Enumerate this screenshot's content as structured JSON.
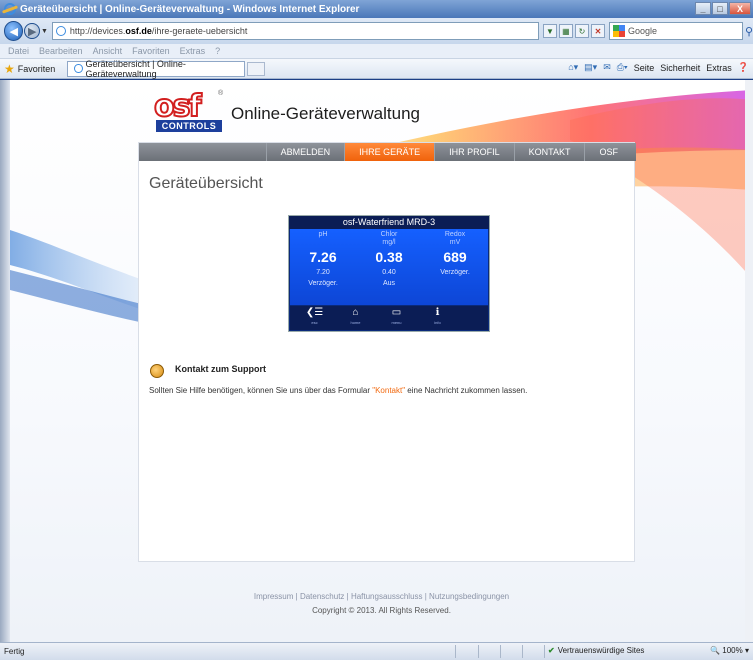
{
  "window": {
    "title": "Geräteübersicht | Online-Geräteverwaltung - Windows Internet Explorer",
    "min": "_",
    "max": "□",
    "close": "X"
  },
  "address": {
    "url_prefix": "http://devices.",
    "url_domain": "osf.de",
    "url_path": "/ihre-geraete-uebersicht",
    "search_engine": "Google"
  },
  "menu": [
    "Datei",
    "Bearbeiten",
    "Ansicht",
    "Favoriten",
    "Extras",
    "?"
  ],
  "favbar": {
    "favorites_label": "Favoriten",
    "tab_title": "Geräteübersicht | Online-Geräteverwaltung",
    "cmd_page": "Seite",
    "cmd_security": "Sicherheit",
    "cmd_extras": "Extras"
  },
  "site": {
    "logo_text": "osf",
    "logo_sub": "CONTROLS",
    "title": "Online-Geräteverwaltung",
    "nav": [
      {
        "label": "ABMELDEN",
        "active": false
      },
      {
        "label": "IHRE GERÄTE",
        "active": true
      },
      {
        "label": "IHR PROFIL",
        "active": false
      },
      {
        "label": "KONTAKT",
        "active": false
      },
      {
        "label": "OSF",
        "active": false
      }
    ],
    "page_heading": "Geräteübersicht"
  },
  "device": {
    "name": "osf-Waterfriend MRD-3",
    "columns": [
      {
        "label": "pH",
        "unit": "",
        "value": "7.26",
        "setpoint": "7.20",
        "mode": "Verzöger."
      },
      {
        "label": "Chlor",
        "unit": "mg/l",
        "value": "0.38",
        "setpoint": "0.40",
        "mode": "Aus"
      },
      {
        "label": "Redox",
        "unit": "mV",
        "value": "689",
        "setpoint": "",
        "mode": "Verzöger."
      }
    ],
    "footer_buttons": [
      {
        "icon": "back-icon",
        "glyph": "❮☰",
        "caption": "esc"
      },
      {
        "icon": "home-icon",
        "glyph": "⌂",
        "caption": "home"
      },
      {
        "icon": "menu-icon",
        "glyph": "▭",
        "caption": "menu"
      },
      {
        "icon": "info-icon",
        "glyph": "ℹ",
        "caption": "info"
      }
    ]
  },
  "support": {
    "title": "Kontakt zum Support",
    "text_before": "Sollten Sie Hilfe benötigen, können Sie uns über das Formular ",
    "link": "\"Kontakt\"",
    "text_after": " eine Nachricht zukommen lassen."
  },
  "footer": {
    "links": "Impressum | Datenschutz | Haftungsausschluss | Nutzungsbedingungen",
    "copyright": "Copyright © 2013. All Rights Reserved."
  },
  "status": {
    "left": "Fertig",
    "zone": "Vertrauenswürdige Sites",
    "zoom": "100%"
  }
}
